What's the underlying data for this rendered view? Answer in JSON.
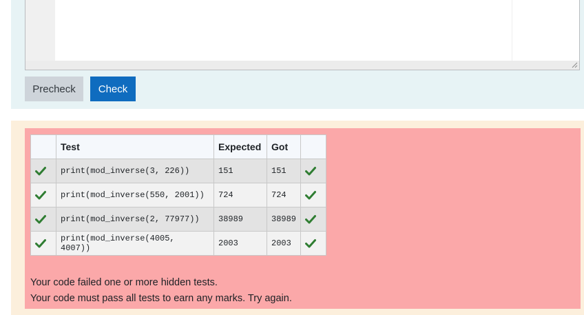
{
  "buttons": {
    "precheck": "Precheck",
    "check": "Check"
  },
  "results": {
    "headers": {
      "mark": "",
      "test": "Test",
      "expected": "Expected",
      "got": "Got",
      "status": ""
    },
    "rows": [
      {
        "test": "print(mod_inverse(3, 226))",
        "expected": "151",
        "got": "151",
        "passed": true
      },
      {
        "test": "print(mod_inverse(550, 2001))",
        "expected": "724",
        "got": "724",
        "passed": true
      },
      {
        "test": "print(mod_inverse(2, 77977))",
        "expected": "38989",
        "got": "38989",
        "passed": true
      },
      {
        "test": "print(mod_inverse(4005, 4007))",
        "expected": "2003",
        "got": "2003",
        "passed": true
      }
    ],
    "message_line1": "Your code failed one or more hidden tests.",
    "message_line2": "Your code must pass all tests to earn any marks. Try again."
  },
  "colors": {
    "pass": "#2f7d32",
    "fail_bg": "#fba8a9",
    "check_btn": "#0f6cbf"
  }
}
